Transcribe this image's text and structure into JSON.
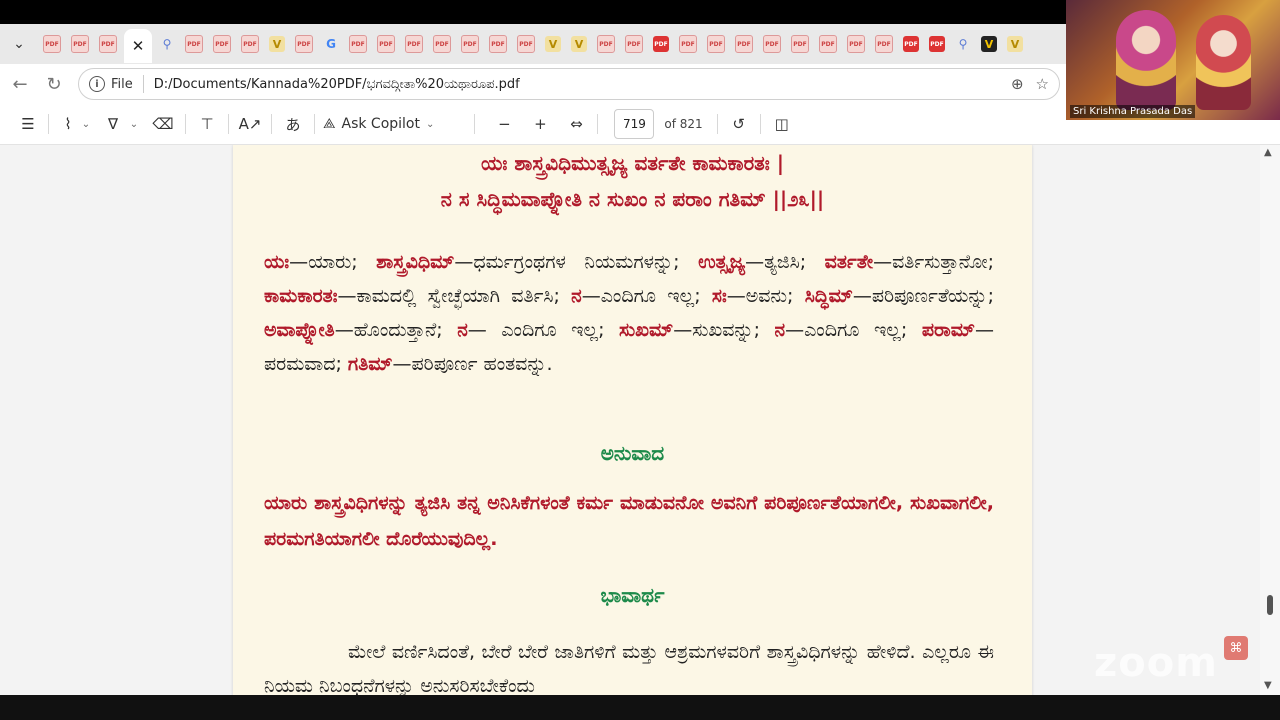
{
  "browser": {
    "tabs": [
      "pdf",
      "pdf",
      "pdf",
      "active",
      "search",
      "pdf",
      "pdf",
      "pdf",
      "v",
      "pdf",
      "google",
      "pdf",
      "pdf",
      "pdf",
      "pdf",
      "pdf",
      "pdf",
      "pdf",
      "v",
      "v",
      "pdf",
      "pdf",
      "pdf-red",
      "pdf",
      "pdf",
      "pdf",
      "pdf",
      "pdf",
      "pdf",
      "pdf",
      "pdf",
      "pdf-red",
      "pdf-red",
      "search",
      "vb",
      "v"
    ],
    "close_glyph": "✕",
    "address": {
      "file_label": "File",
      "url": "D:/Documents/Kannada%20PDF/ಭಗವದ್ಗೀತಾ%20ಯಥಾರೂಪ.pdf"
    }
  },
  "pdf_toolbar": {
    "copilot_label": "Ask Copilot",
    "current_page": "719",
    "page_count": "of 821"
  },
  "document": {
    "verse_line1": "ಯಃ ಶಾಸ್ತ್ರವಿಧಿಮುತ್ಸೃಜ್ಯ ವರ್ತತೇ ಕಾಮಕಾರತಃ |",
    "verse_line2": "ನ ಸ ಸಿದ್ಧಿಮವಾಪ್ನೋತಿ ನ ಸುಖಂ ನ ಪರಾಂ ಗತಿಮ್ ||೨೩||",
    "word_meanings": [
      {
        "k": "ಯಃ",
        "m": "—ಯಾರು; "
      },
      {
        "k": "ಶಾಸ್ತ್ರವಿಧಿಮ್",
        "m": "—ಧರ್ಮಗ್ರಂಥಗಳ ನಿಯಮಗಳನ್ನು; "
      },
      {
        "k": "ಉತ್ಸೃಜ್ಯ",
        "m": "—ತ್ಯಜಿಸಿ; "
      },
      {
        "k": "ವರ್ತತೇ",
        "m": "—ವರ್ತಿಸುತ್ತಾನೋ; "
      },
      {
        "k": "ಕಾಮಕಾರತಃ",
        "m": "—ಕಾಮದಲ್ಲಿ ಸ್ವೇಚ್ಛೆಯಾಗಿ ವರ್ತಿಸಿ; "
      },
      {
        "k": "ನ",
        "m": "—ಎಂದಿಗೂ ಇಲ್ಲ; "
      },
      {
        "k": "ಸಃ",
        "m": "—ಅವನು; "
      },
      {
        "k": "ಸಿದ್ಧಿಮ್",
        "m": "—ಪರಿಪೂರ್ಣತೆಯನ್ನು; "
      },
      {
        "k": "ಅವಾಪ್ನೋತಿ",
        "m": "—ಹೊಂದುತ್ತಾನೆ; "
      },
      {
        "k": "ನ",
        "m": "— ಎಂದಿಗೂ ಇಲ್ಲ; "
      },
      {
        "k": "ಸುಖಮ್",
        "m": "—ಸುಖವನ್ನು; "
      },
      {
        "k": "ನ",
        "m": "—ಎಂದಿಗೂ ಇಲ್ಲ; "
      },
      {
        "k": "ಪರಾಮ್",
        "m": "—ಪರಮವಾದ; "
      },
      {
        "k": "ಗತಿಮ್",
        "m": "—ಪರಿಪೂರ್ಣ ಹಂತವನ್ನು."
      }
    ],
    "translation_heading": "ಅನುವಾದ",
    "translation_text": "ಯಾರು ಶಾಸ್ತ್ರವಿಧಿಗಳನ್ನು ತ್ಯಜಿಸಿ ತನ್ನ ಅನಿಸಿಕೆಗಳಂತೆ ಕರ್ಮ ಮಾಡುವನೋ ಅವನಿಗೆ ಪರಿಪೂರ್ಣತೆಯಾಗಲೀ, ಸುಖವಾಗಲೀ, ಪರಮಗತಿಯಾಗಲೀ ದೊರೆಯುವುದಿಲ್ಲ.",
    "purport_heading": "ಭಾವಾರ್ಥ",
    "purport_text": "ಮೇಲೆ ವರ್ಣಿಸಿದಂತೆ, ಬೇರೆ ಬೇರೆ ಜಾತಿಗಳಿಗೆ ಮತ್ತು ಆಶ್ರಮಗಳವರಿಗೆ ಶಾಸ್ತ್ರವಿಧಿಗಳನ್ನು ಹೇಳಿದೆ. ಎಲ್ಲರೂ ಈ ನಿಯಮ ನಿಬಂಧನೆಗಳನ್ನು ಅನುಸರಿಸಬೇಕೆಂದು"
  },
  "video": {
    "participant_name": "Sri Krishna Prasada Das"
  },
  "watermark": "zoom",
  "colors": {
    "verse_red": "#b01a2b",
    "heading_green": "#1d8a4a",
    "page_bg": "#fcf7e6"
  }
}
